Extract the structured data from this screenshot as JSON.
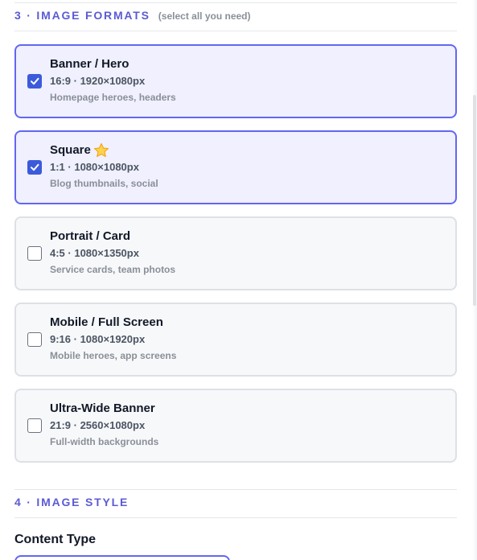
{
  "section3": {
    "title": "3 · IMAGE FORMATS",
    "hint": "(select all you need)"
  },
  "formats": [
    {
      "name": "Banner / Hero",
      "spec": "16:9 · 1920×1080px",
      "usage": "Homepage heroes, headers",
      "checked": true,
      "starred": false
    },
    {
      "name": "Square",
      "spec": "1:1 · 1080×1080px",
      "usage": "Blog thumbnails, social",
      "checked": true,
      "starred": true
    },
    {
      "name": "Portrait / Card",
      "spec": "4:5 · 1080×1350px",
      "usage": "Service cards, team photos",
      "checked": false,
      "starred": false
    },
    {
      "name": "Mobile / Full Screen",
      "spec": "9:16 · 1080×1920px",
      "usage": "Mobile heroes, app screens",
      "checked": false,
      "starred": false
    },
    {
      "name": "Ultra-Wide Banner",
      "spec": "21:9 · 2560×1080px",
      "usage": "Full-width backgrounds",
      "checked": false,
      "starred": false
    }
  ],
  "section4": {
    "title": "4 · IMAGE STYLE"
  },
  "content_type": {
    "label": "Content Type"
  },
  "colors": {
    "accent": "#5b5bd6",
    "selected_border": "#6366f1",
    "selected_bg": "#f0f0ff",
    "checkbox_checked": "#3b5bdb"
  },
  "icons": {
    "check": "checkmark-icon",
    "star": "star-icon"
  }
}
